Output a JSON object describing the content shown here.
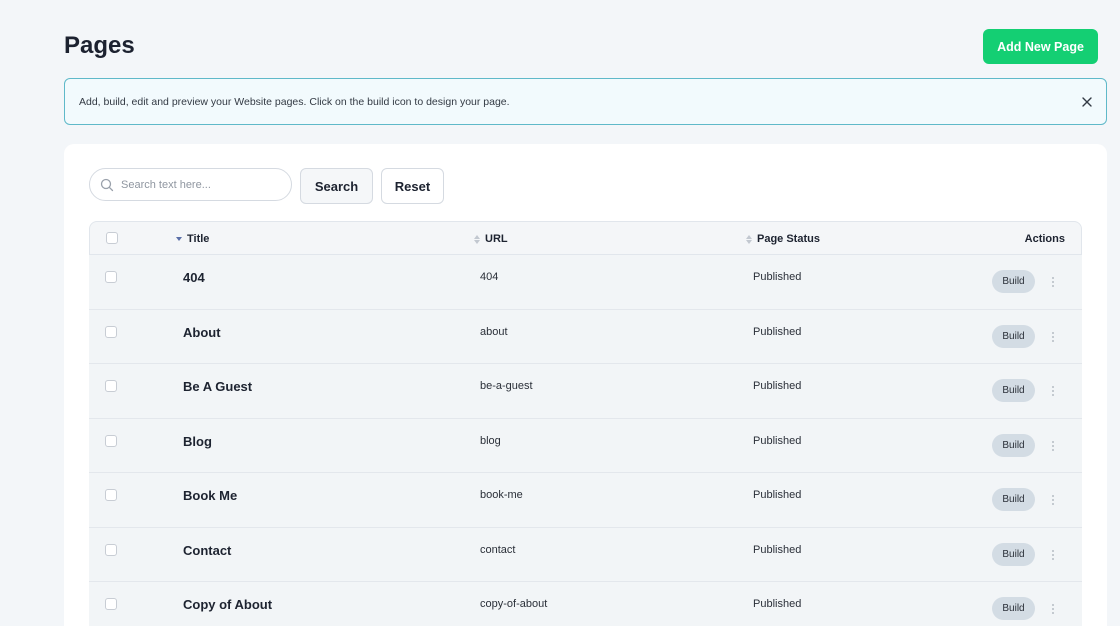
{
  "header": {
    "title": "Pages",
    "add_button_label": "Add New Page"
  },
  "banner": {
    "text": "Add, build, edit and preview your Website pages. Click on the build icon to design your page."
  },
  "toolbar": {
    "search_placeholder": "Search text here...",
    "search_value": "",
    "search_label": "Search",
    "reset_label": "Reset"
  },
  "table": {
    "columns": {
      "title": "Title",
      "url": "URL",
      "status": "Page Status",
      "actions": "Actions"
    },
    "build_label": "Build",
    "rows": [
      {
        "title": "404",
        "url": "404",
        "status": "Published"
      },
      {
        "title": "About",
        "url": "about",
        "status": "Published"
      },
      {
        "title": "Be A Guest",
        "url": "be-a-guest",
        "status": "Published"
      },
      {
        "title": "Blog",
        "url": "blog",
        "status": "Published"
      },
      {
        "title": "Book Me",
        "url": "book-me",
        "status": "Published"
      },
      {
        "title": "Contact",
        "url": "contact",
        "status": "Published"
      },
      {
        "title": "Copy of About",
        "url": "copy-of-about",
        "status": "Published"
      }
    ]
  },
  "colors": {
    "accent": "#14cf73",
    "banner_border": "#5fb9c9",
    "background": "#f3f6f9"
  },
  "icons": [
    "search-icon",
    "close-icon",
    "sort-icon",
    "kebab-icon"
  ]
}
